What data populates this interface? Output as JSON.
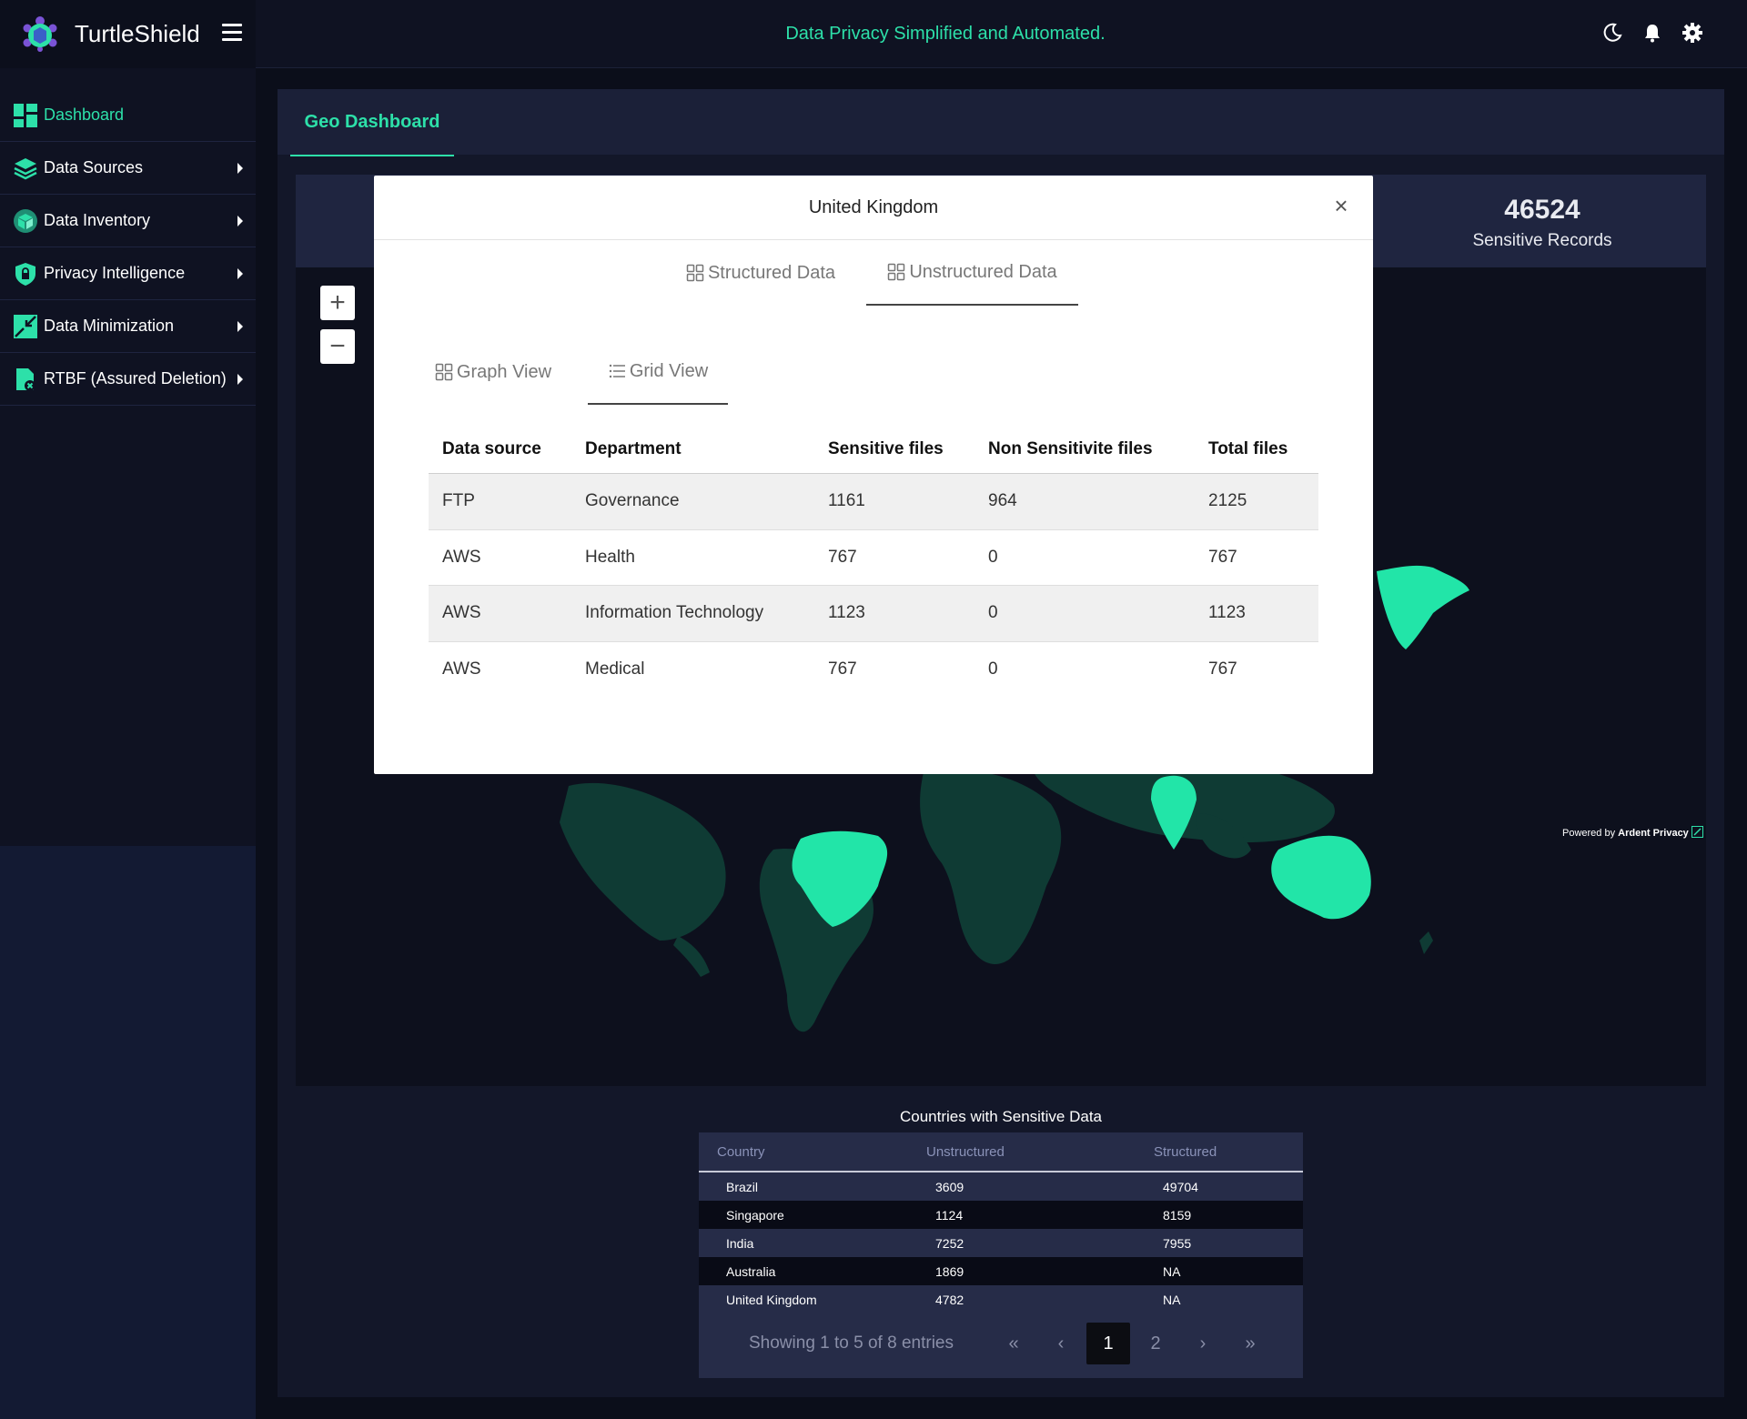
{
  "brand": {
    "name": "TurtleShield"
  },
  "topbar": {
    "tagline": "Data Privacy Simplified and Automated."
  },
  "sidebar": {
    "items": [
      {
        "label": "Dashboard",
        "icon": "dashboard-grid-icon",
        "active": true
      },
      {
        "label": "Data Sources",
        "icon": "layers-icon"
      },
      {
        "label": "Data Inventory",
        "icon": "inventory-box-icon"
      },
      {
        "label": "Privacy Intelligence",
        "icon": "shield-lock-icon"
      },
      {
        "label": "Data Minimization",
        "icon": "minimize-arrows-icon"
      },
      {
        "label": "RTBF (Assured Deletion)",
        "icon": "file-delete-icon"
      }
    ]
  },
  "page": {
    "tab": "Geo Dashboard"
  },
  "stat": {
    "value": "46524",
    "label": "Sensitive Records"
  },
  "powered": {
    "prefix": "Powered by",
    "brand": "Ardent Privacy"
  },
  "modal": {
    "title": "United Kingdom",
    "close": "×",
    "tabs": [
      "Structured Data",
      "Unstructured Data"
    ],
    "views": [
      "Graph View",
      "Grid View"
    ],
    "grid": {
      "columns": [
        "Data source",
        "Department",
        "Sensitive files",
        "Non Sensitivite files",
        "Total files"
      ],
      "rows": [
        [
          "FTP",
          "Governance",
          "1161",
          "964",
          "2125"
        ],
        [
          "AWS",
          "Health",
          "767",
          "0",
          "767"
        ],
        [
          "AWS",
          "Information Technology",
          "1123",
          "0",
          "1123"
        ],
        [
          "AWS",
          "Medical",
          "767",
          "0",
          "767"
        ]
      ]
    }
  },
  "countries": {
    "title": "Countries with Sensitive Data",
    "columns": [
      "Country",
      "Unstructured",
      "Structured"
    ],
    "rows": [
      [
        "Brazil",
        "3609",
        "49704"
      ],
      [
        "Singapore",
        "1124",
        "8159"
      ],
      [
        "India",
        "7252",
        "7955"
      ],
      [
        "Australia",
        "1869",
        "NA"
      ],
      [
        "United Kingdom",
        "4782",
        "NA"
      ]
    ],
    "pager": {
      "summary": "Showing 1 to 5 of 8 entries",
      "first": "«",
      "prev": "‹",
      "pages": [
        "1",
        "2"
      ],
      "next": "›",
      "last": "»"
    }
  },
  "colors": {
    "accent": "#2de0a9",
    "map_land": "#0f3b34",
    "map_highlight": "#22e5a8"
  }
}
